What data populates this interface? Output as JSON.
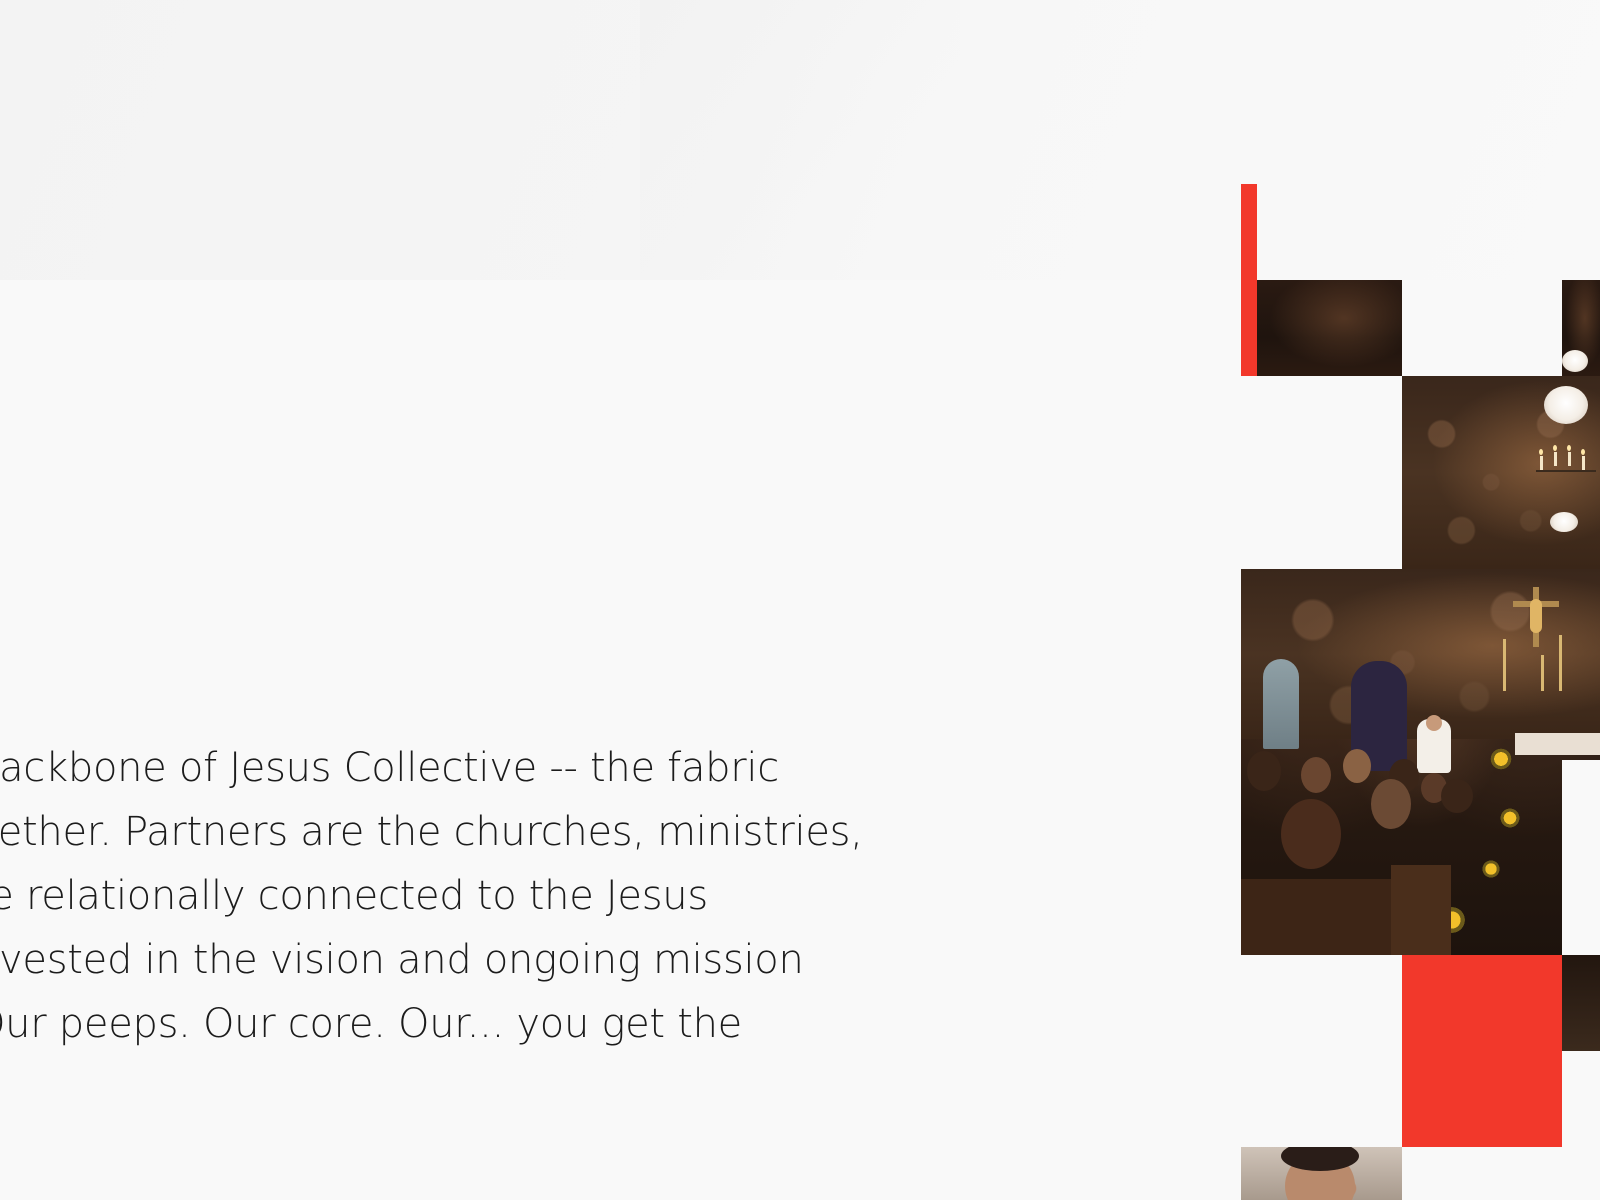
{
  "intro": {
    "lines": [
      "backbone of Jesus Collective -- the fabric",
      "gether. Partners are the churches, ministries,",
      "re relationally connected to the Jesus",
      "nvested in the vision and ongoing mission",
      " Our peeps. Our core. Our... you get the"
    ]
  },
  "colors": {
    "background": "#f9f9f9",
    "text": "#1c1c1c",
    "accent_red": "#f2382b"
  },
  "collage": {
    "photos": [
      "church-interior-photo",
      "congregation-photo",
      "portrait-photo"
    ]
  }
}
